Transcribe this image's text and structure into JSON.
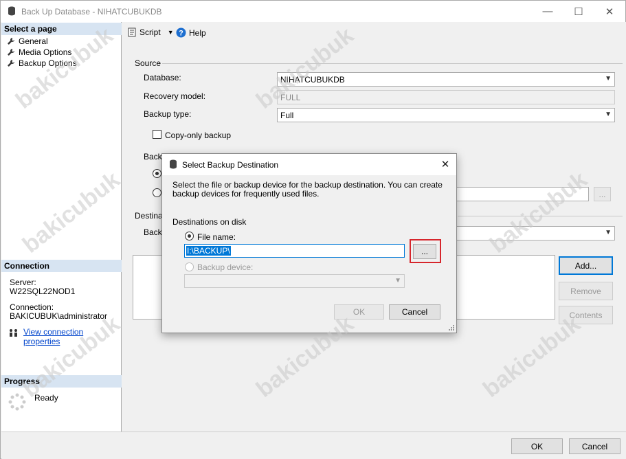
{
  "window": {
    "title": "Back Up Database - NIHATCUBUKDB",
    "minimize_glyph": "—",
    "maximize_glyph": "☐",
    "close_glyph": "✕"
  },
  "left": {
    "select_page_header": "Select a page",
    "pages": [
      {
        "label": "General",
        "icon": "wrench-icon"
      },
      {
        "label": "Media Options",
        "icon": "wrench-icon"
      },
      {
        "label": "Backup Options",
        "icon": "wrench-icon"
      }
    ],
    "connection_header": "Connection",
    "server_label": "Server:",
    "server_value": "W22SQL22NOD1",
    "connection_label": "Connection:",
    "connection_value": "BAKICUBUK\\administrator",
    "view_connection_link": "View connection properties",
    "progress_header": "Progress",
    "progress_status": "Ready"
  },
  "toolbar": {
    "script_label": "Script",
    "help_label": "Help"
  },
  "main": {
    "source_label": "Source",
    "database_label": "Database:",
    "database_value": "NIHATCUBUKDB",
    "recovery_model_label": "Recovery model:",
    "recovery_model_value": "FULL",
    "backup_type_label": "Backup type:",
    "backup_type_value": "Full",
    "copy_only_label": "Copy-only backup",
    "backup_component_label": "Backu",
    "destination_label": "Destinati",
    "back_up_to_label": "Back",
    "add_button": "Add...",
    "remove_button": "Remove",
    "contents_button": "Contents",
    "ellipsis": "..."
  },
  "dialog": {
    "title": "Select Backup Destination",
    "close_glyph": "✕",
    "description": "Select the file or backup device for the backup destination. You can create backup devices for frequently used files.",
    "destinations_label": "Destinations on disk",
    "file_name_label": "File name:",
    "file_name_value": "I:\\BACKUP\\",
    "browse_button": "...",
    "backup_device_label": "Backup device:",
    "ok_button": "OK",
    "cancel_button": "Cancel",
    "highlight_color": "#d6262c"
  },
  "footer": {
    "ok_button": "OK",
    "cancel_button": "Cancel"
  },
  "watermark": "bakicubuk"
}
